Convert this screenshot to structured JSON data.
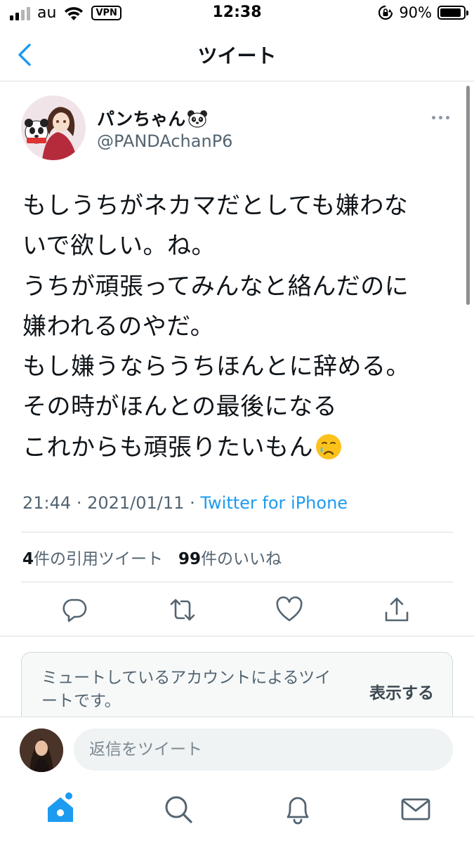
{
  "status_bar": {
    "carrier": "au",
    "vpn": "VPN",
    "time": "12:38",
    "battery": "90%",
    "battery_level": 0.9
  },
  "header": {
    "title": "ツイート",
    "back_icon": "chevron-left-icon"
  },
  "tweet": {
    "author_name": "パンちゃん",
    "author_emoji": "panda-face",
    "author_handle": "@PANDAchanP6",
    "body_lines": [
      "もしうちがネカマだとしても嫌わな",
      "いで欲しい。ね。",
      "うちが頑張ってみんなと絡んだのに",
      "嫌われるのやだ。",
      "もし嫌うならうちほんとに辞める。",
      "その時がほんとの最後になる",
      "これからも頑張りたいもん"
    ],
    "body_end_emoji": "crying-face",
    "time": "21:44",
    "separator": "·",
    "date": "2021/01/11",
    "source": "Twitter for iPhone"
  },
  "stats": {
    "quote_count": "4",
    "quote_label": "件の引用ツイート",
    "like_count": "99",
    "like_label": "件のいいね"
  },
  "actions": [
    "reply-icon",
    "retweet-icon",
    "like-icon",
    "share-icon"
  ],
  "muted": {
    "text": "ミュートしているアカウントによるツイートです。",
    "show_label": "表示する"
  },
  "reply": {
    "placeholder": "返信をツイート"
  },
  "tabs": [
    "home-icon",
    "search-icon",
    "notifications-icon",
    "messages-icon"
  ],
  "colors": {
    "accent": "#1d9bf0",
    "secondary_text": "#536471"
  }
}
